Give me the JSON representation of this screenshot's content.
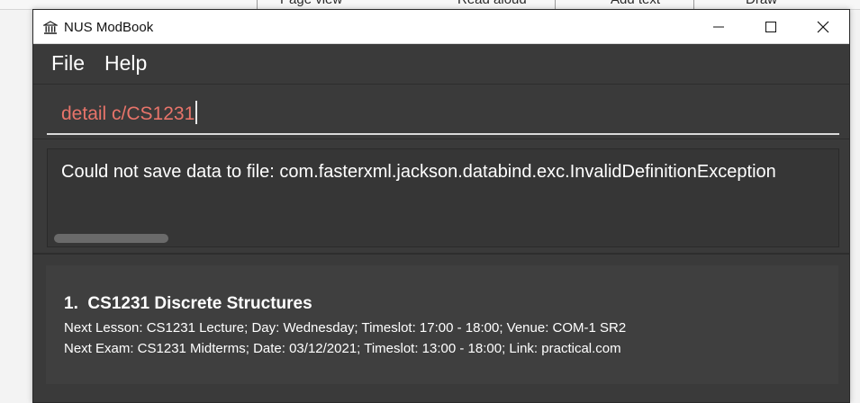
{
  "background_toolbar": {
    "items": [
      "Page view",
      "Read aloud",
      "Add text",
      "Draw"
    ]
  },
  "window": {
    "title": "NUS ModBook",
    "icon": "bank-icon",
    "controls": {
      "minimize": "minimize-icon",
      "maximize": "maximize-icon",
      "close": "close-icon"
    }
  },
  "menu": {
    "file": "File",
    "help": "Help"
  },
  "command": {
    "value": "detail c/CS1231"
  },
  "result": {
    "message": "Could not save data to file: com.fasterxml.jackson.databind.exc.InvalidDefinitionException"
  },
  "modules": [
    {
      "index": "1.",
      "title": "CS1231 Discrete Structures",
      "next_lesson": "Next Lesson: CS1231 Lecture; Day: Wednesday; Timeslot: 17:00 - 18:00; Venue: COM-1 SR2",
      "next_exam": "Next Exam: CS1231 Midterms; Date: 03/12/2021; Timeslot: 13:00 - 18:00; Link: practical.com"
    }
  ],
  "colors": {
    "command_text": "#e8746a",
    "window_bg": "#3a3a3a",
    "card_bg": "#3f3f3f"
  }
}
